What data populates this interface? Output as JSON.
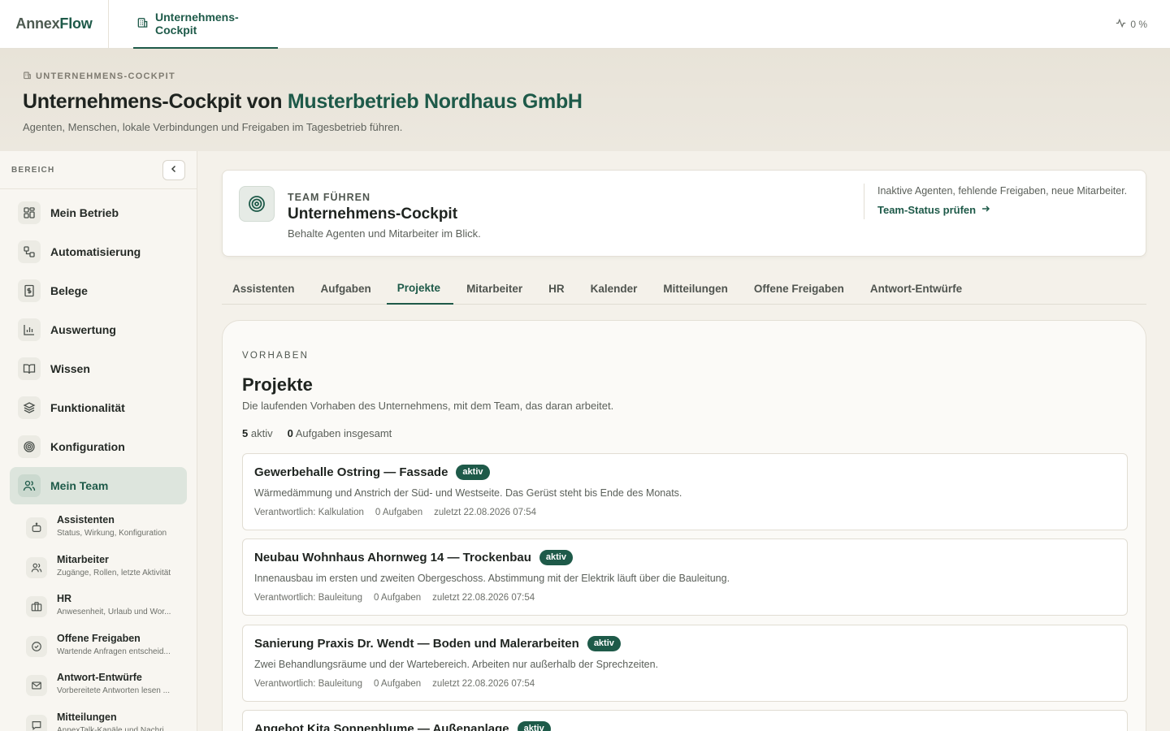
{
  "brand": {
    "part1": "Annex",
    "part2": "Flow"
  },
  "topbar": {
    "tab_label": "Unternehmens-Cockpit",
    "status": "0 %"
  },
  "colors": {
    "accent": "#1e5a49",
    "background": "#f4f1ea",
    "active_nav": "#dde5dd"
  },
  "hero": {
    "kicker": "UNTERNEHMENS-COCKPIT",
    "title_prefix": "Unternehmens-Cockpit von",
    "company": "Musterbetrieb Nordhaus GmbH",
    "subtitle": "Agenten, Menschen, lokale Verbindungen und Freigaben im Tagesbetrieb führen."
  },
  "sidebar": {
    "label": "BEREICH",
    "items": [
      {
        "label": "Mein Betrieb",
        "icon": "grid-icon"
      },
      {
        "label": "Automatisierung",
        "icon": "workflow-icon"
      },
      {
        "label": "Belege",
        "icon": "receipt-icon"
      },
      {
        "label": "Auswertung",
        "icon": "bar-chart-icon"
      },
      {
        "label": "Wissen",
        "icon": "book-icon"
      },
      {
        "label": "Funktionalität",
        "icon": "layers-icon"
      },
      {
        "label": "Konfiguration",
        "icon": "target-icon"
      },
      {
        "label": "Mein Team",
        "icon": "users-icon"
      }
    ],
    "sub_items": [
      {
        "title": "Assistenten",
        "desc": "Status, Wirkung, Konfiguration"
      },
      {
        "title": "Mitarbeiter",
        "desc": "Zugänge, Rollen, letzte Aktivität"
      },
      {
        "title": "HR",
        "desc": "Anwesenheit, Urlaub und Wor..."
      },
      {
        "title": "Offene Freigaben",
        "desc": "Wartende Anfragen entscheid..."
      },
      {
        "title": "Antwort-Entwürfe",
        "desc": "Vorbereitete Antworten lesen ..."
      },
      {
        "title": "Mitteilungen",
        "desc": "AnnexTalk-Kanäle und Nachri..."
      }
    ]
  },
  "team_card": {
    "kicker": "TEAM FÜHREN",
    "title": "Unternehmens-Cockpit",
    "desc": "Behalte Agenten und Mitarbeiter im Blick.",
    "side_text": "Inaktive Agenten, fehlende Freigaben, neue Mitarbeiter.",
    "side_link": "Team-Status prüfen"
  },
  "tabs": [
    "Assistenten",
    "Aufgaben",
    "Projekte",
    "Mitarbeiter",
    "HR",
    "Kalender",
    "Mitteilungen",
    "Offene Freigaben",
    "Antwort-Entwürfe"
  ],
  "active_tab": "Projekte",
  "panel": {
    "kicker": "VORHABEN",
    "title": "Projekte",
    "desc": "Die laufenden Vorhaben des Unternehmens, mit dem Team, das daran arbeitet.",
    "stat_active_num": "5",
    "stat_active_label": "aktiv",
    "stat_tasks_num": "0",
    "stat_tasks_label": "Aufgaben insgesamt"
  },
  "projects": [
    {
      "title": "Gewerbehalle Ostring — Fassade",
      "badge": "aktiv",
      "desc": "Wärmedämmung und Anstrich der Süd- und Westseite. Das Gerüst steht bis Ende des Monats.",
      "owner": "Verantwortlich: Kalkulation",
      "tasks": "0 Aufgaben",
      "updated": "zuletzt 22.08.2026 07:54"
    },
    {
      "title": "Neubau Wohnhaus Ahornweg 14 — Trockenbau",
      "badge": "aktiv",
      "desc": "Innenausbau im ersten und zweiten Obergeschoss. Abstimmung mit der Elektrik läuft über die Bauleitung.",
      "owner": "Verantwortlich: Bauleitung",
      "tasks": "0 Aufgaben",
      "updated": "zuletzt 22.08.2026 07:54"
    },
    {
      "title": "Sanierung Praxis Dr. Wendt — Boden und Malerarbeiten",
      "badge": "aktiv",
      "desc": "Zwei Behandlungsräume und der Wartebereich. Arbeiten nur außerhalb der Sprechzeiten.",
      "owner": "Verantwortlich: Bauleitung",
      "tasks": "0 Aufgaben",
      "updated": "zuletzt 22.08.2026 07:54"
    },
    {
      "title": "Angebot Kita Sonnenblume — Außenanlage",
      "badge": "aktiv",
      "desc": "",
      "owner": "",
      "tasks": "",
      "updated": ""
    }
  ]
}
